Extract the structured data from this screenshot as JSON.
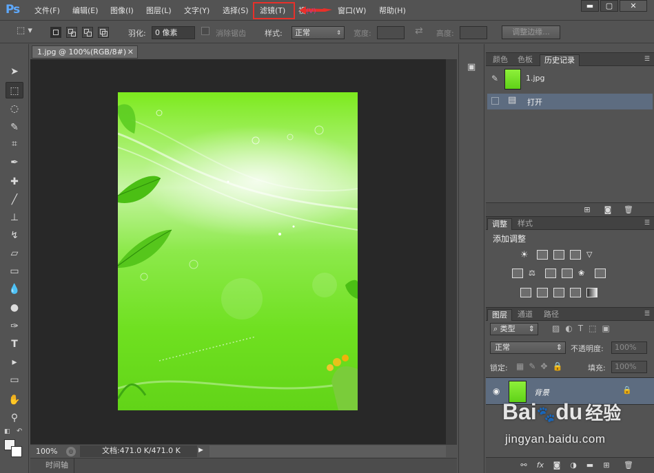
{
  "app": {
    "logo": "Ps"
  },
  "menu": {
    "items": [
      "文件(F)",
      "编辑(E)",
      "图像(I)",
      "图层(L)",
      "文字(Y)",
      "选择(S)",
      "滤镜(T)",
      "视图(V)",
      "窗口(W)",
      "帮助(H)"
    ],
    "highlighted": "滤镜(T)",
    "highlight_color": "#e8302a",
    "view_visible_text": "视",
    "view_partial": "(V)"
  },
  "window_controls": {
    "minimize": "▬",
    "restore": "▢",
    "close": "✕"
  },
  "options": {
    "feather_label": "羽化:",
    "feather_value": "0 像素",
    "antialias_label": "消除锯齿",
    "style_label": "样式:",
    "style_value": "正常",
    "width_label": "宽度:",
    "height_label": "高度:",
    "refine_edge": "调整边缘..."
  },
  "document": {
    "tab_title": "1.jpg @ 100%(RGB/8#)",
    "zoom": "100%",
    "doc_size": "文档:471.0 K/471.0 K",
    "timeline": "时间轴"
  },
  "history_panel": {
    "tabs": [
      "颜色",
      "色板",
      "历史记录"
    ],
    "active_tab": "历史记录",
    "snapshot_name": "1.jpg",
    "states": [
      "打开"
    ]
  },
  "adjustments_panel": {
    "tabs": [
      "调整",
      "样式"
    ],
    "active_tab": "调整",
    "heading": "添加调整"
  },
  "layers_panel": {
    "tabs": [
      "图层",
      "通道",
      "路径"
    ],
    "active_tab": "图层",
    "filter_kind": "类型",
    "blend_mode": "正常",
    "opacity_label": "不透明度:",
    "opacity_value": "100%",
    "lock_label": "锁定:",
    "fill_label": "填充:",
    "fill_value": "100%",
    "layers": [
      {
        "name": "背景",
        "locked": true
      }
    ]
  },
  "watermark": {
    "brand_prefix": "Bai",
    "brand_suffix": "du",
    "brand_cn": "经验",
    "url": "jingyan.baidu.com"
  },
  "colors": {
    "accent": "#5ea9ff",
    "highlight": "#e8302a",
    "selected_row": "#5d6c80"
  }
}
